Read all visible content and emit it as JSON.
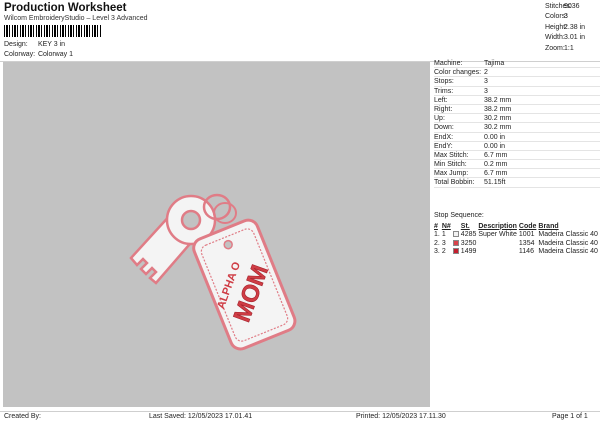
{
  "header": {
    "title": "Production Worksheet",
    "subtitle": "Wilcom EmbroideryStudio – Level 3 Advanced",
    "design_label": "Design:",
    "design_value": "KEY 3 in",
    "colorway_label": "Colorway:",
    "colorway_value": "Colorway 1"
  },
  "stats": [
    {
      "label": "Stitches:",
      "value": "9036"
    },
    {
      "label": "Colors:",
      "value": "3"
    },
    {
      "label": "Height:",
      "value": "2.38 in"
    },
    {
      "label": "Width:",
      "value": "3.01 in"
    },
    {
      "label": "Zoom:",
      "value": "1:1"
    }
  ],
  "details": [
    {
      "label": "Machine:",
      "value": "Tajima"
    },
    {
      "label": "Color changes:",
      "value": "2"
    },
    {
      "label": "Stops:",
      "value": "3"
    },
    {
      "label": "Trims:",
      "value": "3"
    },
    {
      "label": "Left:",
      "value": "38.2 mm"
    },
    {
      "label": "Right:",
      "value": "38.2 mm"
    },
    {
      "label": "Up:",
      "value": "30.2 mm"
    },
    {
      "label": "Down:",
      "value": "30.2 mm"
    },
    {
      "label": "EndX:",
      "value": "0.00 in"
    },
    {
      "label": "EndY:",
      "value": "0.00 in"
    },
    {
      "label": "Max Stitch:",
      "value": "6.7 mm"
    },
    {
      "label": "Min Stitch:",
      "value": "0.2 mm"
    },
    {
      "label": "Max Jump:",
      "value": "6.7 mm"
    },
    {
      "label": "Total Bobbin:",
      "value": "51.15ft"
    }
  ],
  "stop_sequence": {
    "title": "Stop Sequence:",
    "columns": [
      "#",
      "N#",
      "St.",
      "Description",
      "Code",
      "Brand"
    ],
    "rows": [
      {
        "num": "1.",
        "n": "1",
        "color": "#f2f2f2",
        "code_top": "4285",
        "desc": "Super White",
        "st": "1001",
        "brand": "Madeira Classic 40"
      },
      {
        "num": "2.",
        "n": "3",
        "color": "#d9434b",
        "code_top": "3250",
        "desc": "",
        "st": "1354",
        "brand": "Madeira Classic 40"
      },
      {
        "num": "3.",
        "n": "2",
        "color": "#c41e2e",
        "code_top": "1499",
        "desc": "",
        "st": "1146",
        "brand": "Madeira Classic 40"
      }
    ]
  },
  "design_text": {
    "line1": "ALPHA O",
    "line2": "MOM"
  },
  "footer": {
    "created_by": "Created By:",
    "last_saved": "Last Saved: 12/05/2023 17.01.41",
    "printed": "Printed: 12/05/2023 17.11.30",
    "page": "Page 1 of 1"
  },
  "colors": {
    "canvas": "#c2c2c2",
    "outline": "#e07c86",
    "fill_white": "#f4f4f4",
    "text_red": "#cf3d45"
  }
}
